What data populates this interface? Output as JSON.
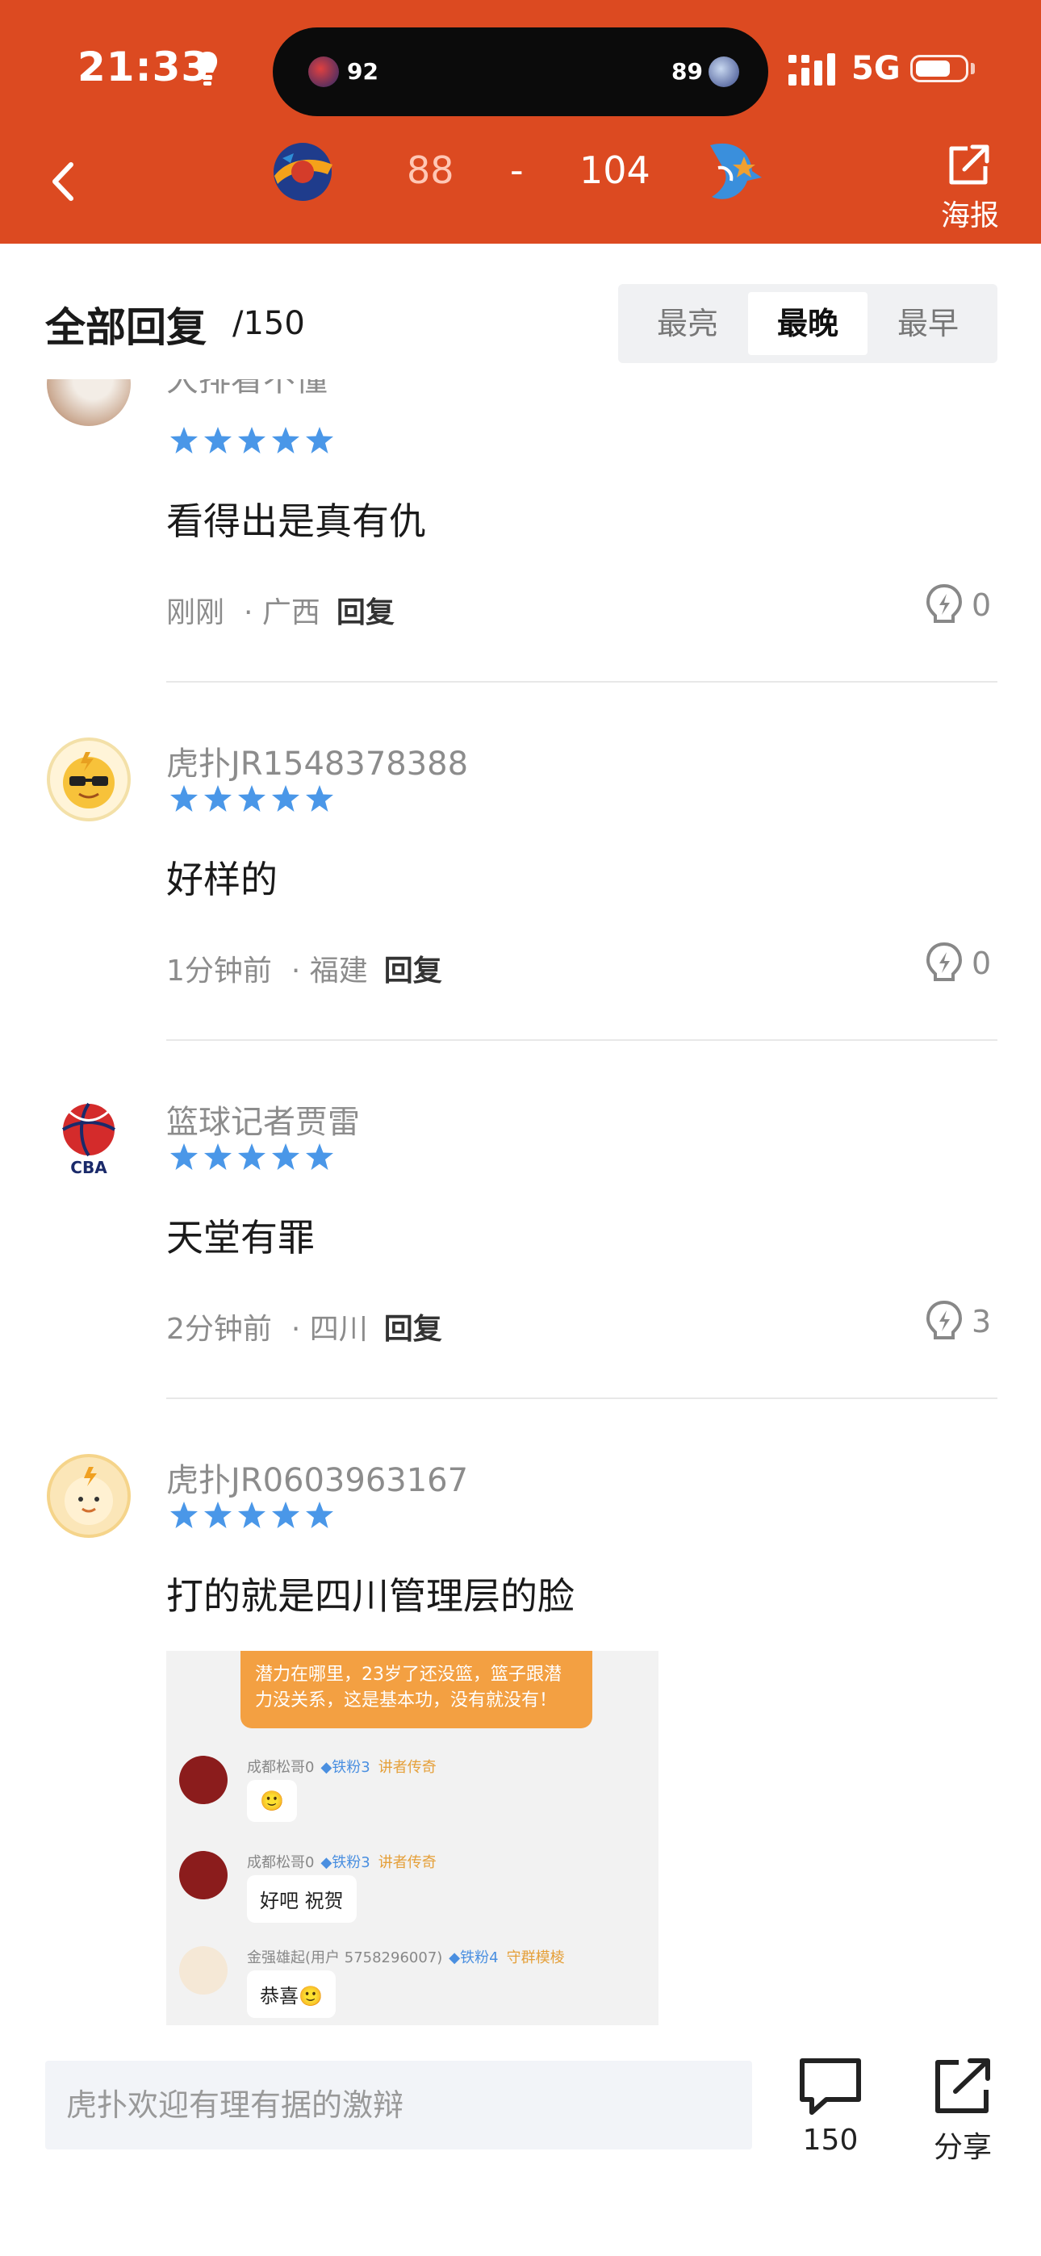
{
  "status_bar": {
    "time": "21:33",
    "network": "5G"
  },
  "island": {
    "home_score": "92",
    "away_score": "89"
  },
  "header": {
    "home_score": "88",
    "separator": "-",
    "away_score": "104",
    "poster_label": "海报"
  },
  "replies": {
    "title": "全部回复",
    "count": "/150"
  },
  "sort_tabs": [
    {
      "label": "最亮",
      "active": false
    },
    {
      "label": "最晚",
      "active": true
    },
    {
      "label": "最早",
      "active": false
    }
  ],
  "comments": [
    {
      "username": "大排看不懂",
      "content": "看得出是真有仇",
      "time": "刚刚",
      "location": "· 广西",
      "reply_label": "回复",
      "likes": "0"
    },
    {
      "username": "虎扑JR1548378388",
      "content": "好样的",
      "time": "1分钟前",
      "location": "· 福建",
      "reply_label": "回复",
      "likes": "0"
    },
    {
      "username": "篮球记者贾雷",
      "content": "天堂有罪",
      "time": "2分钟前",
      "location": "· 四川",
      "reply_label": "回复",
      "likes": "3"
    },
    {
      "username": "虎扑JR0603963167",
      "content": "打的就是四川管理层的脸",
      "time": "",
      "location": "",
      "reply_label": "",
      "likes": ""
    }
  ],
  "embedded_screenshot": {
    "bubble_text": "潜力在哪里，23岁了还没篮，篮子跟潜力没关系，这是基本功，没有就没有！",
    "messages": [
      {
        "name": "成都松哥0",
        "level": "◆铁粉3",
        "tag": "讲者传奇",
        "text": "🙂"
      },
      {
        "name": "成都松哥0",
        "level": "◆铁粉3",
        "tag": "讲者传奇",
        "text": "好吧 祝贺"
      },
      {
        "name": "金强雄起(用户 5758296007)",
        "level": "◆铁粉4",
        "tag": "守群模棱",
        "text": "恭喜🙂"
      }
    ]
  },
  "bottom_bar": {
    "input_placeholder": "虎扑欢迎有理有据的激辩",
    "comment_count": "150",
    "share_label": "分享"
  },
  "colors": {
    "brand": "#dc4a21",
    "star": "#4a97e8"
  }
}
